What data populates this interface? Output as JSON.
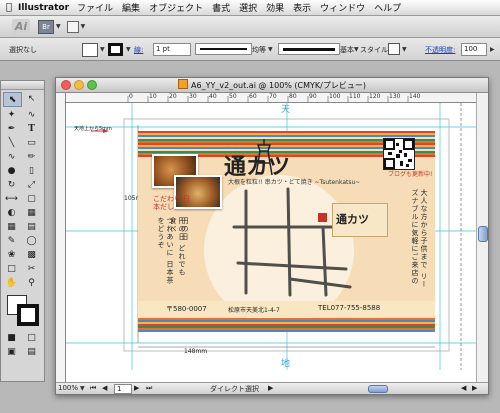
{
  "menubar": {
    "app": "Illustrator",
    "items": [
      "ファイル",
      "編集",
      "オブジェクト",
      "書式",
      "選択",
      "効果",
      "表示",
      "ウィンドウ",
      "ヘルプ"
    ]
  },
  "appbar": {
    "logo": "Ai",
    "bridge_label": "Br"
  },
  "control": {
    "selection_label": "選択なし",
    "stroke_label": "線:",
    "stroke_weight": "1 pt",
    "profile_label": "均等",
    "brush_label": "基本",
    "style_label": "スタイル :",
    "opacity_label": "不透明度:",
    "opacity_value": "100"
  },
  "document": {
    "title": "A6_YY_v2_out.ai @ 100% (CMYK/プレビュー)",
    "zoom": "100%",
    "artboard": "1",
    "tool_status": "ダイレクト選択",
    "ruler_numbers": [
      "0",
      "10",
      "20",
      "30",
      "40",
      "50",
      "60",
      "70",
      "80",
      "90",
      "100",
      "110",
      "120",
      "130",
      "140"
    ]
  },
  "artwork": {
    "top_label": "天",
    "bottom_label": "地",
    "left_annotation": "天地上から5mm",
    "height_label": "105mm",
    "width_label": "148mm",
    "shop_name": "通カツ",
    "catch": "大根を粒粒!! 串カツ・どて焼き ~Tsutenkatsu~",
    "slogan_left": "こだわり 日本だし",
    "vert_left_1": "円の日",
    "vert_left_2": "円の日 どれでも 食べ",
    "vert_left_3": "つれあいに 日本茶をどうぞ",
    "vert_right": "大人な方から子供まで リーズナブルに気軽にご来店の",
    "blog": "ブログも更新中!",
    "map_label": "通カツ",
    "postal": "〒580-0007",
    "address": "松原市天美北1-4-7",
    "phone": "TEL077-755-8588"
  },
  "colors": {
    "accent_red": "#c9312a",
    "guide_cyan": "#3fc9d6",
    "card_bg": "#f6ddb7"
  }
}
